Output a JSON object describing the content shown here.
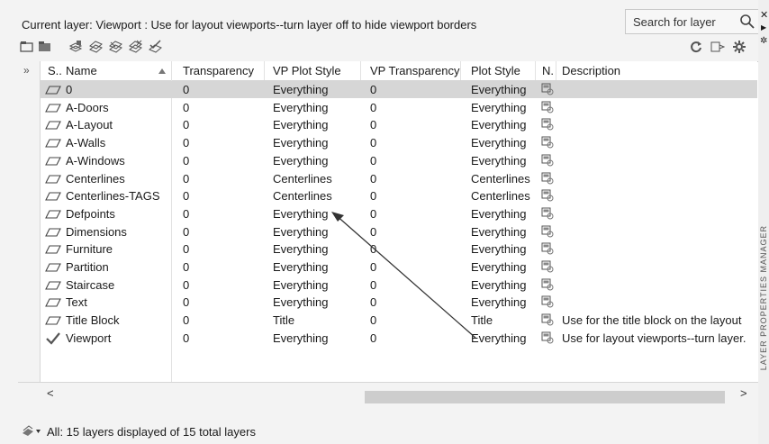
{
  "header": {
    "current_layer": "Current layer: Viewport : Use for layout viewports--turn layer off to hide viewport borders",
    "search_placeholder": "Search for layer"
  },
  "toolbar": {
    "left_icons": [
      "new-property-filter-icon",
      "new-group-filter-icon",
      "layer-states-manager-icon",
      "new-layer-icon",
      "new-layer-vp-frozen-icon",
      "delete-layer-icon",
      "set-current-icon"
    ],
    "right_icons": [
      "refresh-icon",
      "settings-toggle-icon",
      "gear-icon"
    ]
  },
  "columns": [
    "S..",
    "Name",
    "Transparency",
    "VP Plot Style",
    "VP Transparency",
    "Plot Style",
    "N.",
    "Description"
  ],
  "rows": [
    {
      "name": "0",
      "transparency": "0",
      "vp_plot_style": "Everything",
      "vp_transparency": "0",
      "plot_style": "Everything",
      "description": ""
    },
    {
      "name": "A-Doors",
      "transparency": "0",
      "vp_plot_style": "Everything",
      "vp_transparency": "0",
      "plot_style": "Everything",
      "description": ""
    },
    {
      "name": "A-Layout",
      "transparency": "0",
      "vp_plot_style": "Everything",
      "vp_transparency": "0",
      "plot_style": "Everything",
      "description": ""
    },
    {
      "name": "A-Walls",
      "transparency": "0",
      "vp_plot_style": "Everything",
      "vp_transparency": "0",
      "plot_style": "Everything",
      "description": ""
    },
    {
      "name": "A-Windows",
      "transparency": "0",
      "vp_plot_style": "Everything",
      "vp_transparency": "0",
      "plot_style": "Everything",
      "description": ""
    },
    {
      "name": "Centerlines",
      "transparency": "0",
      "vp_plot_style": "Centerlines",
      "vp_transparency": "0",
      "plot_style": "Centerlines",
      "description": ""
    },
    {
      "name": "Centerlines-TAGS",
      "transparency": "0",
      "vp_plot_style": "Centerlines",
      "vp_transparency": "0",
      "plot_style": "Centerlines",
      "description": ""
    },
    {
      "name": "Defpoints",
      "transparency": "0",
      "vp_plot_style": "Everything",
      "vp_transparency": "0",
      "plot_style": "Everything",
      "description": ""
    },
    {
      "name": "Dimensions",
      "transparency": "0",
      "vp_plot_style": "Everything",
      "vp_transparency": "0",
      "plot_style": "Everything",
      "description": ""
    },
    {
      "name": "Furniture",
      "transparency": "0",
      "vp_plot_style": "Everything",
      "vp_transparency": "0",
      "plot_style": "Everything",
      "description": ""
    },
    {
      "name": "Partition",
      "transparency": "0",
      "vp_plot_style": "Everything",
      "vp_transparency": "0",
      "plot_style": "Everything",
      "description": ""
    },
    {
      "name": "Staircase",
      "transparency": "0",
      "vp_plot_style": "Everything",
      "vp_transparency": "0",
      "plot_style": "Everything",
      "description": ""
    },
    {
      "name": "Text",
      "transparency": "0",
      "vp_plot_style": "Everything",
      "vp_transparency": "0",
      "plot_style": "Everything",
      "description": ""
    },
    {
      "name": "Title Block",
      "transparency": "0",
      "vp_plot_style": "Title",
      "vp_transparency": "0",
      "plot_style": "Title",
      "description": "Use for the title block on the layout"
    },
    {
      "name": "Viewport",
      "transparency": "0",
      "vp_plot_style": "Everything",
      "vp_transparency": "0",
      "plot_style": "Everything",
      "description": "Use for layout viewports--turn layer."
    }
  ],
  "status_text": "All: 15 layers displayed of 15 total layers",
  "side_label": "LAYER PROPERTIES MANAGER",
  "expand_glyph": "»",
  "scroll_left": "<",
  "scroll_right": ">"
}
